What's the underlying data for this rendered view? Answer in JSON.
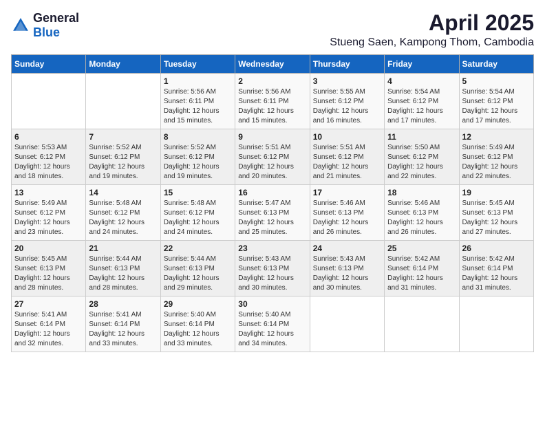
{
  "logo": {
    "general": "General",
    "blue": "Blue"
  },
  "title": "April 2025",
  "subtitle": "Stueng Saen, Kampong Thom, Cambodia",
  "days_header": [
    "Sunday",
    "Monday",
    "Tuesday",
    "Wednesday",
    "Thursday",
    "Friday",
    "Saturday"
  ],
  "weeks": [
    [
      {
        "num": "",
        "sunrise": "",
        "sunset": "",
        "daylight": ""
      },
      {
        "num": "",
        "sunrise": "",
        "sunset": "",
        "daylight": ""
      },
      {
        "num": "1",
        "sunrise": "Sunrise: 5:56 AM",
        "sunset": "Sunset: 6:11 PM",
        "daylight": "Daylight: 12 hours and 15 minutes."
      },
      {
        "num": "2",
        "sunrise": "Sunrise: 5:56 AM",
        "sunset": "Sunset: 6:11 PM",
        "daylight": "Daylight: 12 hours and 15 minutes."
      },
      {
        "num": "3",
        "sunrise": "Sunrise: 5:55 AM",
        "sunset": "Sunset: 6:12 PM",
        "daylight": "Daylight: 12 hours and 16 minutes."
      },
      {
        "num": "4",
        "sunrise": "Sunrise: 5:54 AM",
        "sunset": "Sunset: 6:12 PM",
        "daylight": "Daylight: 12 hours and 17 minutes."
      },
      {
        "num": "5",
        "sunrise": "Sunrise: 5:54 AM",
        "sunset": "Sunset: 6:12 PM",
        "daylight": "Daylight: 12 hours and 17 minutes."
      }
    ],
    [
      {
        "num": "6",
        "sunrise": "Sunrise: 5:53 AM",
        "sunset": "Sunset: 6:12 PM",
        "daylight": "Daylight: 12 hours and 18 minutes."
      },
      {
        "num": "7",
        "sunrise": "Sunrise: 5:52 AM",
        "sunset": "Sunset: 6:12 PM",
        "daylight": "Daylight: 12 hours and 19 minutes."
      },
      {
        "num": "8",
        "sunrise": "Sunrise: 5:52 AM",
        "sunset": "Sunset: 6:12 PM",
        "daylight": "Daylight: 12 hours and 19 minutes."
      },
      {
        "num": "9",
        "sunrise": "Sunrise: 5:51 AM",
        "sunset": "Sunset: 6:12 PM",
        "daylight": "Daylight: 12 hours and 20 minutes."
      },
      {
        "num": "10",
        "sunrise": "Sunrise: 5:51 AM",
        "sunset": "Sunset: 6:12 PM",
        "daylight": "Daylight: 12 hours and 21 minutes."
      },
      {
        "num": "11",
        "sunrise": "Sunrise: 5:50 AM",
        "sunset": "Sunset: 6:12 PM",
        "daylight": "Daylight: 12 hours and 22 minutes."
      },
      {
        "num": "12",
        "sunrise": "Sunrise: 5:49 AM",
        "sunset": "Sunset: 6:12 PM",
        "daylight": "Daylight: 12 hours and 22 minutes."
      }
    ],
    [
      {
        "num": "13",
        "sunrise": "Sunrise: 5:49 AM",
        "sunset": "Sunset: 6:12 PM",
        "daylight": "Daylight: 12 hours and 23 minutes."
      },
      {
        "num": "14",
        "sunrise": "Sunrise: 5:48 AM",
        "sunset": "Sunset: 6:12 PM",
        "daylight": "Daylight: 12 hours and 24 minutes."
      },
      {
        "num": "15",
        "sunrise": "Sunrise: 5:48 AM",
        "sunset": "Sunset: 6:12 PM",
        "daylight": "Daylight: 12 hours and 24 minutes."
      },
      {
        "num": "16",
        "sunrise": "Sunrise: 5:47 AM",
        "sunset": "Sunset: 6:13 PM",
        "daylight": "Daylight: 12 hours and 25 minutes."
      },
      {
        "num": "17",
        "sunrise": "Sunrise: 5:46 AM",
        "sunset": "Sunset: 6:13 PM",
        "daylight": "Daylight: 12 hours and 26 minutes."
      },
      {
        "num": "18",
        "sunrise": "Sunrise: 5:46 AM",
        "sunset": "Sunset: 6:13 PM",
        "daylight": "Daylight: 12 hours and 26 minutes."
      },
      {
        "num": "19",
        "sunrise": "Sunrise: 5:45 AM",
        "sunset": "Sunset: 6:13 PM",
        "daylight": "Daylight: 12 hours and 27 minutes."
      }
    ],
    [
      {
        "num": "20",
        "sunrise": "Sunrise: 5:45 AM",
        "sunset": "Sunset: 6:13 PM",
        "daylight": "Daylight: 12 hours and 28 minutes."
      },
      {
        "num": "21",
        "sunrise": "Sunrise: 5:44 AM",
        "sunset": "Sunset: 6:13 PM",
        "daylight": "Daylight: 12 hours and 28 minutes."
      },
      {
        "num": "22",
        "sunrise": "Sunrise: 5:44 AM",
        "sunset": "Sunset: 6:13 PM",
        "daylight": "Daylight: 12 hours and 29 minutes."
      },
      {
        "num": "23",
        "sunrise": "Sunrise: 5:43 AM",
        "sunset": "Sunset: 6:13 PM",
        "daylight": "Daylight: 12 hours and 30 minutes."
      },
      {
        "num": "24",
        "sunrise": "Sunrise: 5:43 AM",
        "sunset": "Sunset: 6:13 PM",
        "daylight": "Daylight: 12 hours and 30 minutes."
      },
      {
        "num": "25",
        "sunrise": "Sunrise: 5:42 AM",
        "sunset": "Sunset: 6:14 PM",
        "daylight": "Daylight: 12 hours and 31 minutes."
      },
      {
        "num": "26",
        "sunrise": "Sunrise: 5:42 AM",
        "sunset": "Sunset: 6:14 PM",
        "daylight": "Daylight: 12 hours and 31 minutes."
      }
    ],
    [
      {
        "num": "27",
        "sunrise": "Sunrise: 5:41 AM",
        "sunset": "Sunset: 6:14 PM",
        "daylight": "Daylight: 12 hours and 32 minutes."
      },
      {
        "num": "28",
        "sunrise": "Sunrise: 5:41 AM",
        "sunset": "Sunset: 6:14 PM",
        "daylight": "Daylight: 12 hours and 33 minutes."
      },
      {
        "num": "29",
        "sunrise": "Sunrise: 5:40 AM",
        "sunset": "Sunset: 6:14 PM",
        "daylight": "Daylight: 12 hours and 33 minutes."
      },
      {
        "num": "30",
        "sunrise": "Sunrise: 5:40 AM",
        "sunset": "Sunset: 6:14 PM",
        "daylight": "Daylight: 12 hours and 34 minutes."
      },
      {
        "num": "",
        "sunrise": "",
        "sunset": "",
        "daylight": ""
      },
      {
        "num": "",
        "sunrise": "",
        "sunset": "",
        "daylight": ""
      },
      {
        "num": "",
        "sunrise": "",
        "sunset": "",
        "daylight": ""
      }
    ]
  ]
}
